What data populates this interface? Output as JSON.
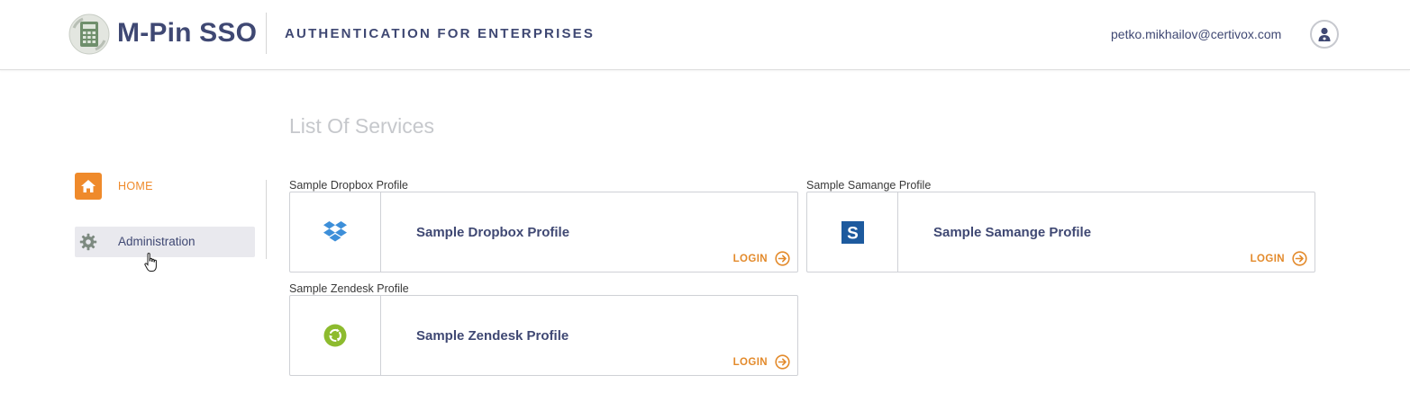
{
  "header": {
    "brand": "M-Pin SSO",
    "tagline": "AUTHENTICATION FOR ENTERPRISES",
    "user_email": "petko.mikhailov@certivox.com"
  },
  "sidebar": {
    "items": [
      {
        "label": "HOME",
        "icon": "home-icon",
        "active": true
      },
      {
        "label": "Administration",
        "icon": "gear-icon",
        "hovered": true
      }
    ]
  },
  "main": {
    "title": "List Of Services",
    "services": [
      {
        "caption": "Sample Dropbox Profile",
        "name": "Sample Dropbox Profile",
        "icon": "dropbox-icon",
        "login_label": "LOGIN"
      },
      {
        "caption": "Sample Samange Profile",
        "name": "Sample Samange Profile",
        "icon": "samange-icon",
        "login_label": "LOGIN"
      },
      {
        "caption": "Sample Zendesk Profile",
        "name": "Sample Zendesk Profile",
        "icon": "zendesk-icon",
        "login_label": "LOGIN"
      }
    ]
  },
  "colors": {
    "brand_navy": "#3f4873",
    "accent_orange": "#ef8a2b",
    "dropbox_blue": "#3d8fd9",
    "samange_blue": "#1d5a9e",
    "zendesk_green": "#8dbb2e"
  }
}
